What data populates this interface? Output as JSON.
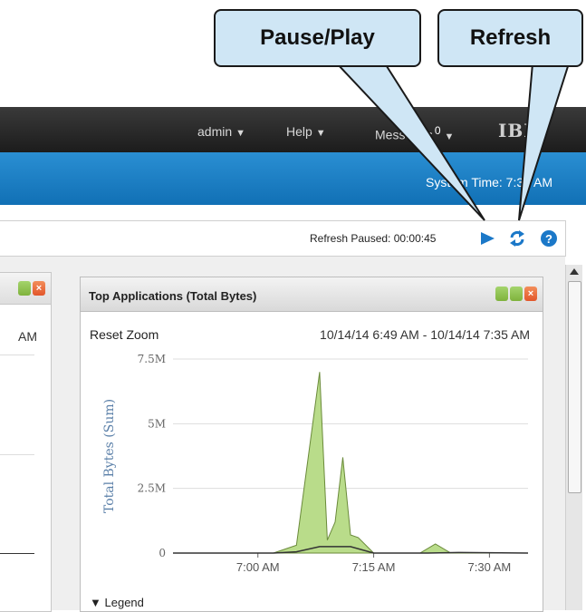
{
  "header": {
    "admin_label": "admin",
    "help_label": "Help",
    "messages_label": "Messages",
    "messages_count": "0",
    "logo_text": "IBM",
    "caret": "▼"
  },
  "bluebar": {
    "system_time": "System Time: 7:34 AM"
  },
  "toolbar": {
    "refresh_paused": "Refresh Paused: 00:00:45",
    "play_icon": "play-icon",
    "refresh_icon": "refresh-icon",
    "help_icon": "help-icon"
  },
  "left_panel": {
    "time_label": "AM"
  },
  "panel": {
    "title": "Top Applications (Total Bytes)",
    "reset_zoom": "Reset Zoom",
    "range": "10/14/14 6:49 AM - 10/14/14 7:35 AM",
    "legend": "Legend",
    "legend_arrow": "▼"
  },
  "callouts": {
    "pause_play": "Pause/Play",
    "refresh": "Refresh"
  },
  "colors": {
    "area_fill": "#b9dc8a",
    "area_stroke": "#6a8a3a",
    "series2": "#333333",
    "accent_blue": "#1b78c8"
  },
  "chart_data": {
    "type": "area",
    "ylabel": "Total Bytes (Sum)",
    "y_ticks": [
      "0",
      "2.5M",
      "5M",
      "7.5M"
    ],
    "ylim": [
      0,
      7500000
    ],
    "x_ticks": [
      "7:00 AM",
      "7:15 AM",
      "7:30 AM"
    ],
    "series": [
      {
        "x": [
          "6:49",
          "6:58",
          "7:02",
          "7:05",
          "7:08",
          "7:09",
          "7:10",
          "7:11",
          "7:12",
          "7:13",
          "7:15",
          "7:17",
          "7:21",
          "7:23",
          "7:25",
          "7:27",
          "7:35"
        ],
        "values": [
          0,
          0,
          0,
          300000,
          7000000,
          500000,
          1200000,
          3700000,
          700000,
          600000,
          0,
          0,
          0,
          350000,
          0,
          0,
          0
        ]
      },
      {
        "x": [
          "6:49",
          "6:58",
          "7:02",
          "7:05",
          "7:08",
          "7:12",
          "7:15",
          "7:22",
          "7:26",
          "7:35"
        ],
        "values": [
          0,
          0,
          0,
          50000,
          250000,
          250000,
          0,
          0,
          20000,
          0
        ]
      }
    ],
    "grid": true
  }
}
